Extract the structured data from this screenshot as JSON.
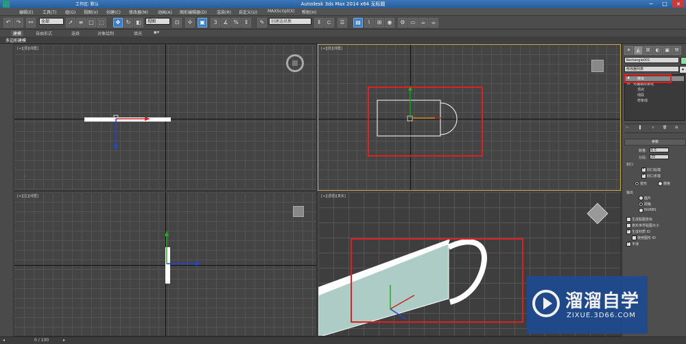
{
  "window": {
    "title": "Autodesk 3ds Max  2014 x64     无标题",
    "workspace": "工作区: 默认"
  },
  "menu": [
    "编辑(E)",
    "工具(T)",
    "组(G)",
    "视图(V)",
    "创建(C)",
    "修改器(M)",
    "动画(A)",
    "图形编辑器(D)",
    "渲染(R)",
    "自定义(U)",
    "MAXScript(X)",
    "帮助(H)"
  ],
  "toolbar": {
    "filter_value": "全部",
    "refcoord_value": "视图",
    "selection_set_placeholder": "创建选择集"
  },
  "ribbon": {
    "tabs": [
      "建模",
      "自由形式",
      "选择",
      "对象绘制",
      "填充"
    ]
  },
  "subtab": "多边形建模",
  "viewports": {
    "top": {
      "label": "[+][顶][线框]"
    },
    "front": {
      "label": "[+][前][线框]"
    },
    "left": {
      "label": "[+][左][线框]"
    },
    "persp": {
      "label": "[+][透视][真实]"
    }
  },
  "panel": {
    "object_name": "Rectangle001",
    "modifier_list": "修改器列表",
    "stack": {
      "extrude": "挤出",
      "editable_spline": "可编辑样条线",
      "vertex": "顶点",
      "segment": "线段",
      "spline": "样条线"
    },
    "params_header": "参数",
    "amount_label": "数量:",
    "amount_value": "6.5",
    "segments_label": "分段:",
    "segments_value": "25",
    "capping_header": "封口",
    "cap_start": "封口始端",
    "cap_end": "封口末端",
    "morph": "变形",
    "grid": "栅格",
    "output_header": "输出",
    "patch": "面片",
    "mesh": "网格",
    "nurbs": "NURBS",
    "gen_mapping": "生成贴图坐标",
    "real_world": "真实世界贴图大小",
    "gen_mat_ids": "生成材质 ID",
    "use_shape_ids": "使用图形 ID",
    "smooth": "平滑"
  },
  "status": {
    "frame": "0 / 100"
  },
  "watermark": {
    "brand": "溜溜自学",
    "url": "ZIXUE.3D66.COM"
  },
  "colors": {
    "highlight_red": "#e02020",
    "active_viewport_border": "#c8a44a",
    "brand_blue": "#1d4a8f"
  }
}
